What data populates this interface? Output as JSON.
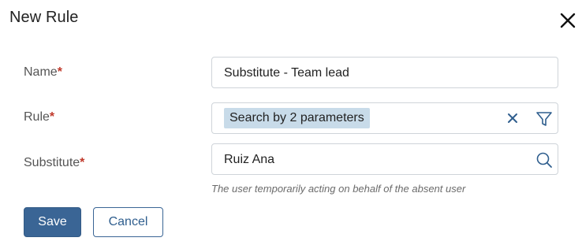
{
  "dialog": {
    "title": "New Rule"
  },
  "form": {
    "name": {
      "label": "Name",
      "required_mark": "*",
      "value": "Substitute - Team lead"
    },
    "rule": {
      "label": "Rule",
      "required_mark": "*",
      "chip_text": "Search by 2 parameters"
    },
    "substitute": {
      "label": "Substitute",
      "required_mark": "*",
      "value": "Ruiz Ana",
      "hint": "The user temporarily acting on behalf of the absent user"
    }
  },
  "actions": {
    "save_label": "Save",
    "cancel_label": "Cancel"
  },
  "icons": {
    "close": "close-icon",
    "clear": "clear-icon",
    "filter": "filter-icon",
    "search": "search-icon"
  },
  "colors": {
    "primary": "#3a6595",
    "chip": "#c8dbe9",
    "required": "#c0392b",
    "border": "#cfd4d9"
  }
}
